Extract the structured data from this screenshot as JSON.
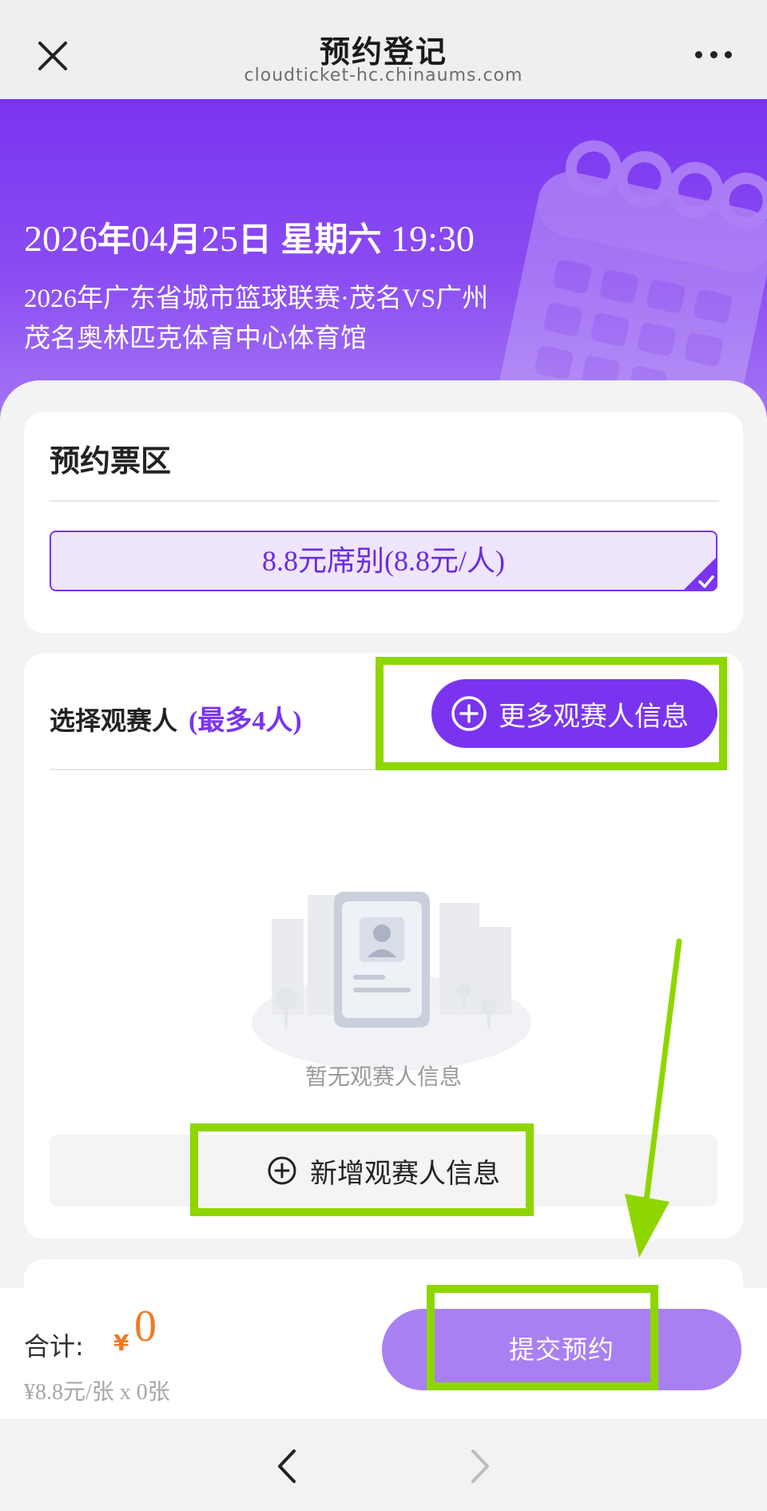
{
  "nav": {
    "title": "预约登记",
    "url": "cloudticket-hc.chinaums.com",
    "close_icon": "close-icon",
    "more_icon": "more-horizontal-icon"
  },
  "event": {
    "date": "2026",
    "year_suffix": "年",
    "month": "04",
    "month_suffix": "月",
    "day": "25",
    "day_suffix": "日",
    "weekday": "星期六",
    "time": "19:30",
    "name": "2026年广东省城市篮球联赛·茂名VS广州",
    "venue": "茂名奥林匹克体育中心体育馆"
  },
  "ticket_section": {
    "title": "预约票区",
    "option_label": "8.8元席别(8.8元/人)",
    "selected": true
  },
  "viewer_section": {
    "title": "选择观赛人",
    "max_label": "(最多4人)",
    "more_button": "更多观赛人信息",
    "empty_text": "暂无观赛人信息",
    "add_button": "新增观赛人信息"
  },
  "footer": {
    "total_label": "合计:",
    "currency": "¥",
    "total_amount": "0",
    "detail": "¥8.8元/张 x 0张",
    "submit_button": "提交预约"
  },
  "colors": {
    "brand_purple": "#7a34f0",
    "submit_disabled": "#a980f2",
    "price_orange": "#ee7b27",
    "highlight_green": "#8ed600"
  }
}
